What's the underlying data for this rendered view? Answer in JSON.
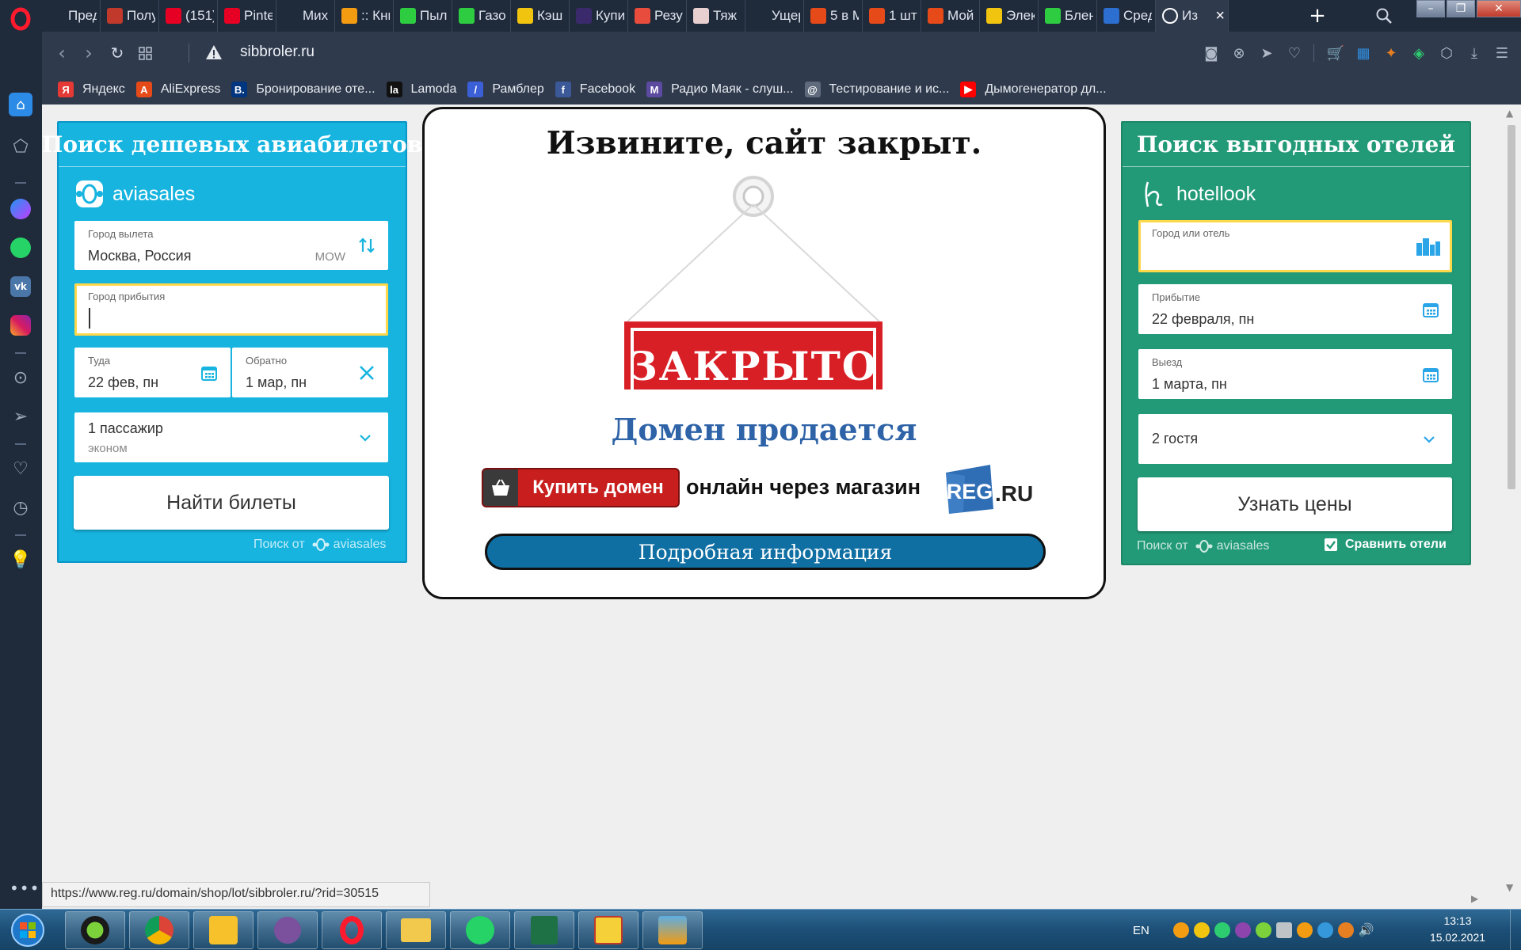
{
  "browser": {
    "tabs": [
      {
        "title": "Пред",
        "icon": "document-icon",
        "color": "#1f2a3b"
      },
      {
        "title": "Полу",
        "icon": "calendar-icon",
        "color": "#c0392b"
      },
      {
        "title": "(151)",
        "icon": "pinterest-icon",
        "color": "#e60023"
      },
      {
        "title": "Pinte",
        "icon": "pinterest-icon",
        "color": "#e60023"
      },
      {
        "title": "Мих",
        "icon": "document-icon",
        "color": "#1f2a3b"
      },
      {
        "title": ":: Кни",
        "icon": "shop-icon",
        "color": "#f39c12"
      },
      {
        "title": "Пыл",
        "icon": "e-icon",
        "color": "#2ecc40"
      },
      {
        "title": "Газо",
        "icon": "e-icon",
        "color": "#2ecc40"
      },
      {
        "title": "Кэш",
        "icon": "l-icon",
        "color": "#f1c40f"
      },
      {
        "title": "Купи",
        "icon": "dns-icon",
        "color": "#3a2a6b"
      },
      {
        "title": "Резу",
        "icon": "vbt-icon",
        "color": "#e74c3c"
      },
      {
        "title": "Тяж",
        "icon": "bird-icon",
        "color": "#e8d0d0"
      },
      {
        "title": "Ущер",
        "icon": "car-icon",
        "color": "#1f2a3b"
      },
      {
        "title": "5 в М",
        "icon": "aliexpress-icon",
        "color": "#e64a19"
      },
      {
        "title": "1 шт",
        "icon": "aliexpress-icon",
        "color": "#e64a19"
      },
      {
        "title": "Мой",
        "icon": "aliexpress-icon",
        "color": "#e64a19"
      },
      {
        "title": "Элек",
        "icon": "leaf-icon",
        "color": "#f1c40f"
      },
      {
        "title": "Блен",
        "icon": "e-icon",
        "color": "#2ecc40"
      },
      {
        "title": "Сред",
        "icon": "f-icon",
        "color": "#2c6fd1"
      },
      {
        "title": "Из",
        "icon": "gear-icon",
        "color": "#ffffff",
        "active": true
      }
    ],
    "new_tab": "+",
    "url": "sibbroler.ru",
    "bookmarks": [
      {
        "label": "Яндекс",
        "icon": "Я",
        "color": "#e53935"
      },
      {
        "label": "AliExpress",
        "icon": "A",
        "color": "#e64a19"
      },
      {
        "label": "Бронирование оте...",
        "icon": "B.",
        "color": "#003580"
      },
      {
        "label": "Lamoda",
        "icon": "la",
        "color": "#111111"
      },
      {
        "label": "Рамблер",
        "icon": "/",
        "color": "#3b5fd6"
      },
      {
        "label": "Facebook",
        "icon": "f",
        "color": "#3b5998"
      },
      {
        "label": "Радио Маяк - слуш...",
        "icon": "M",
        "color": "#5c4aa0"
      },
      {
        "label": "Тестирование и ис...",
        "icon": "@",
        "color": "#5f6b7d"
      },
      {
        "label": "Дымогенератор дл...",
        "icon": "▶",
        "color": "#ff0000"
      }
    ],
    "status_url": "https://www.reg.ru/domain/shop/lot/sibbroler.ru/?rid=30515"
  },
  "flights": {
    "title": "Поиск дешевых авиабилетов",
    "brand": "aviasales",
    "origin_label": "Город вылета",
    "origin_value": "Москва, Россия",
    "origin_code": "MOW",
    "dest_label": "Город прибытия",
    "dest_value": "",
    "depart_label": "Туда",
    "depart_value": "22 фев, пн",
    "return_label": "Обратно",
    "return_value": "1 мар, пн",
    "passengers": "1 пассажир",
    "cabin": "эконом",
    "search_button": "Найти билеты",
    "powered_by": "Поиск от",
    "powered_brand": "aviasales",
    "bg_color": "#16b4df"
  },
  "closed": {
    "title": "Извините, сайт закрыт.",
    "sign_text": "ЗАКРЫТО",
    "sale_text": "Домен продается",
    "buy_button": "Купить домен",
    "buy_via": "онлайн через магазин",
    "registrar": "REG",
    "registrar_tld": ".RU",
    "more_button": "Подробная информация"
  },
  "hotels": {
    "title": "Поиск выгодных отелей",
    "brand": "hotellook",
    "city_label": "Город или отель",
    "city_value": "",
    "arrival_label": "Прибытие",
    "arrival_value": "22 февраля, пн",
    "departure_label": "Выезд",
    "departure_value": "1 марта, пн",
    "guests": "2 гостя",
    "search_button": "Узнать цены",
    "powered_by": "Поиск от",
    "powered_brand": "aviasales",
    "compare_label": "Сравнить отели",
    "compare_checked": true,
    "bg_color": "#229a77"
  },
  "taskbar": {
    "lang": "EN",
    "time": "13:13",
    "date": "15.02.2021"
  }
}
